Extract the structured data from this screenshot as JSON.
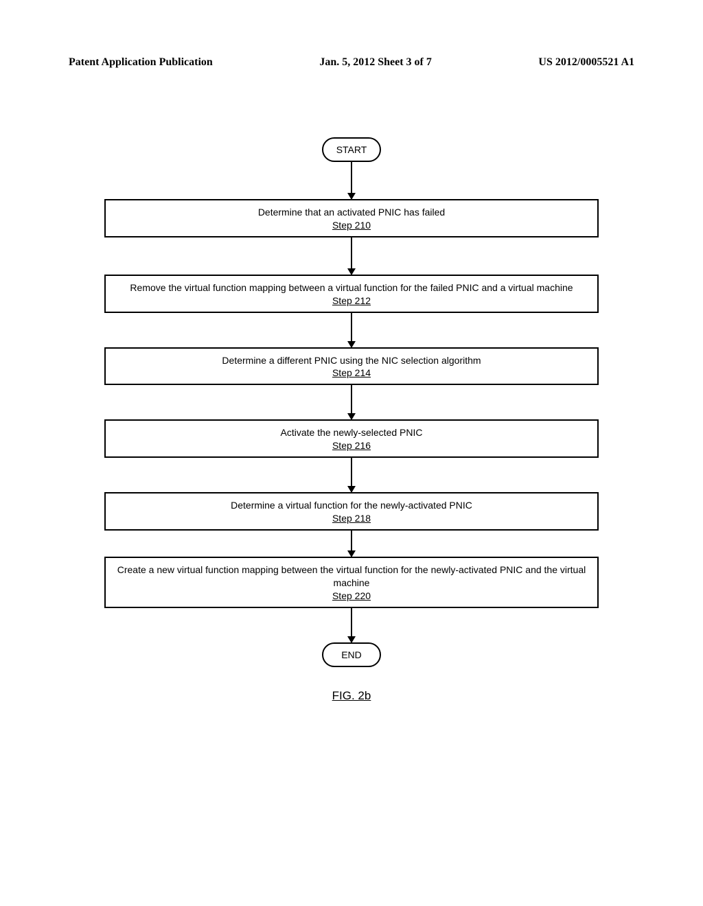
{
  "header": {
    "left": "Patent Application Publication",
    "center": "Jan. 5, 2012  Sheet 3 of 7",
    "right": "US 2012/0005521 A1"
  },
  "flow": {
    "start_label": "START",
    "end_label": "END",
    "steps": [
      {
        "text": "Determine that an activated PNIC has failed",
        "step": "Step 210"
      },
      {
        "text": "Remove the virtual function mapping between a virtual function for the failed PNIC and a virtual machine",
        "step": "Step 212"
      },
      {
        "text": "Determine a different PNIC using the NIC selection algorithm",
        "step": "Step 214"
      },
      {
        "text": "Activate the newly-selected PNIC",
        "step": "Step 216"
      },
      {
        "text": "Determine a virtual function for the newly-activated PNIC",
        "step": "Step 218"
      },
      {
        "text": "Create a new virtual function mapping between the virtual function for the newly-activated PNIC and the virtual machine",
        "step": "Step 220"
      }
    ]
  },
  "figure_label": "FIG. 2b"
}
